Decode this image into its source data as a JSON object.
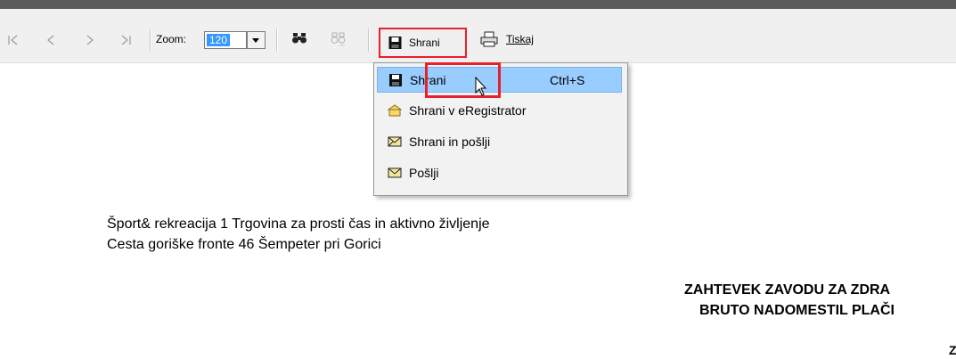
{
  "toolbar": {
    "zoom_label": "Zoom:",
    "zoom_value": "120",
    "save_label": "Shrani",
    "print_label": "Tiskaj",
    "icons": [
      "first-page-icon",
      "prev-page-icon",
      "next-page-icon",
      "last-page-icon",
      "find-icon",
      "find-next-icon",
      "save-icon",
      "print-icon"
    ]
  },
  "save_menu": {
    "items": [
      {
        "label": "Shrani",
        "shortcut": "Ctrl+S",
        "icon": "save-icon",
        "highlighted": true
      },
      {
        "label": "Shrani v eRegistrator",
        "icon": "folder-icon"
      },
      {
        "label": "Shrani in pošlji",
        "icon": "envelope-icon"
      },
      {
        "label": "Pošlji",
        "icon": "envelope-icon"
      }
    ]
  },
  "document": {
    "line1": "Šport& rekreacija 1 Trgovina za prosti čas in aktivno življenje",
    "line2": "Cesta goriške fronte 46 Šempeter pri Gorici",
    "heading1": "ZAHTEVEK ZAVODU ZA ZDRA",
    "heading2": "BRUTO NADOMESTIL PLAČI",
    "corner_char": "Z"
  },
  "colors": {
    "highlight": "#99ccff",
    "annotation_red": "#e8202a",
    "toolbar_bg": "#f0f0f0"
  }
}
